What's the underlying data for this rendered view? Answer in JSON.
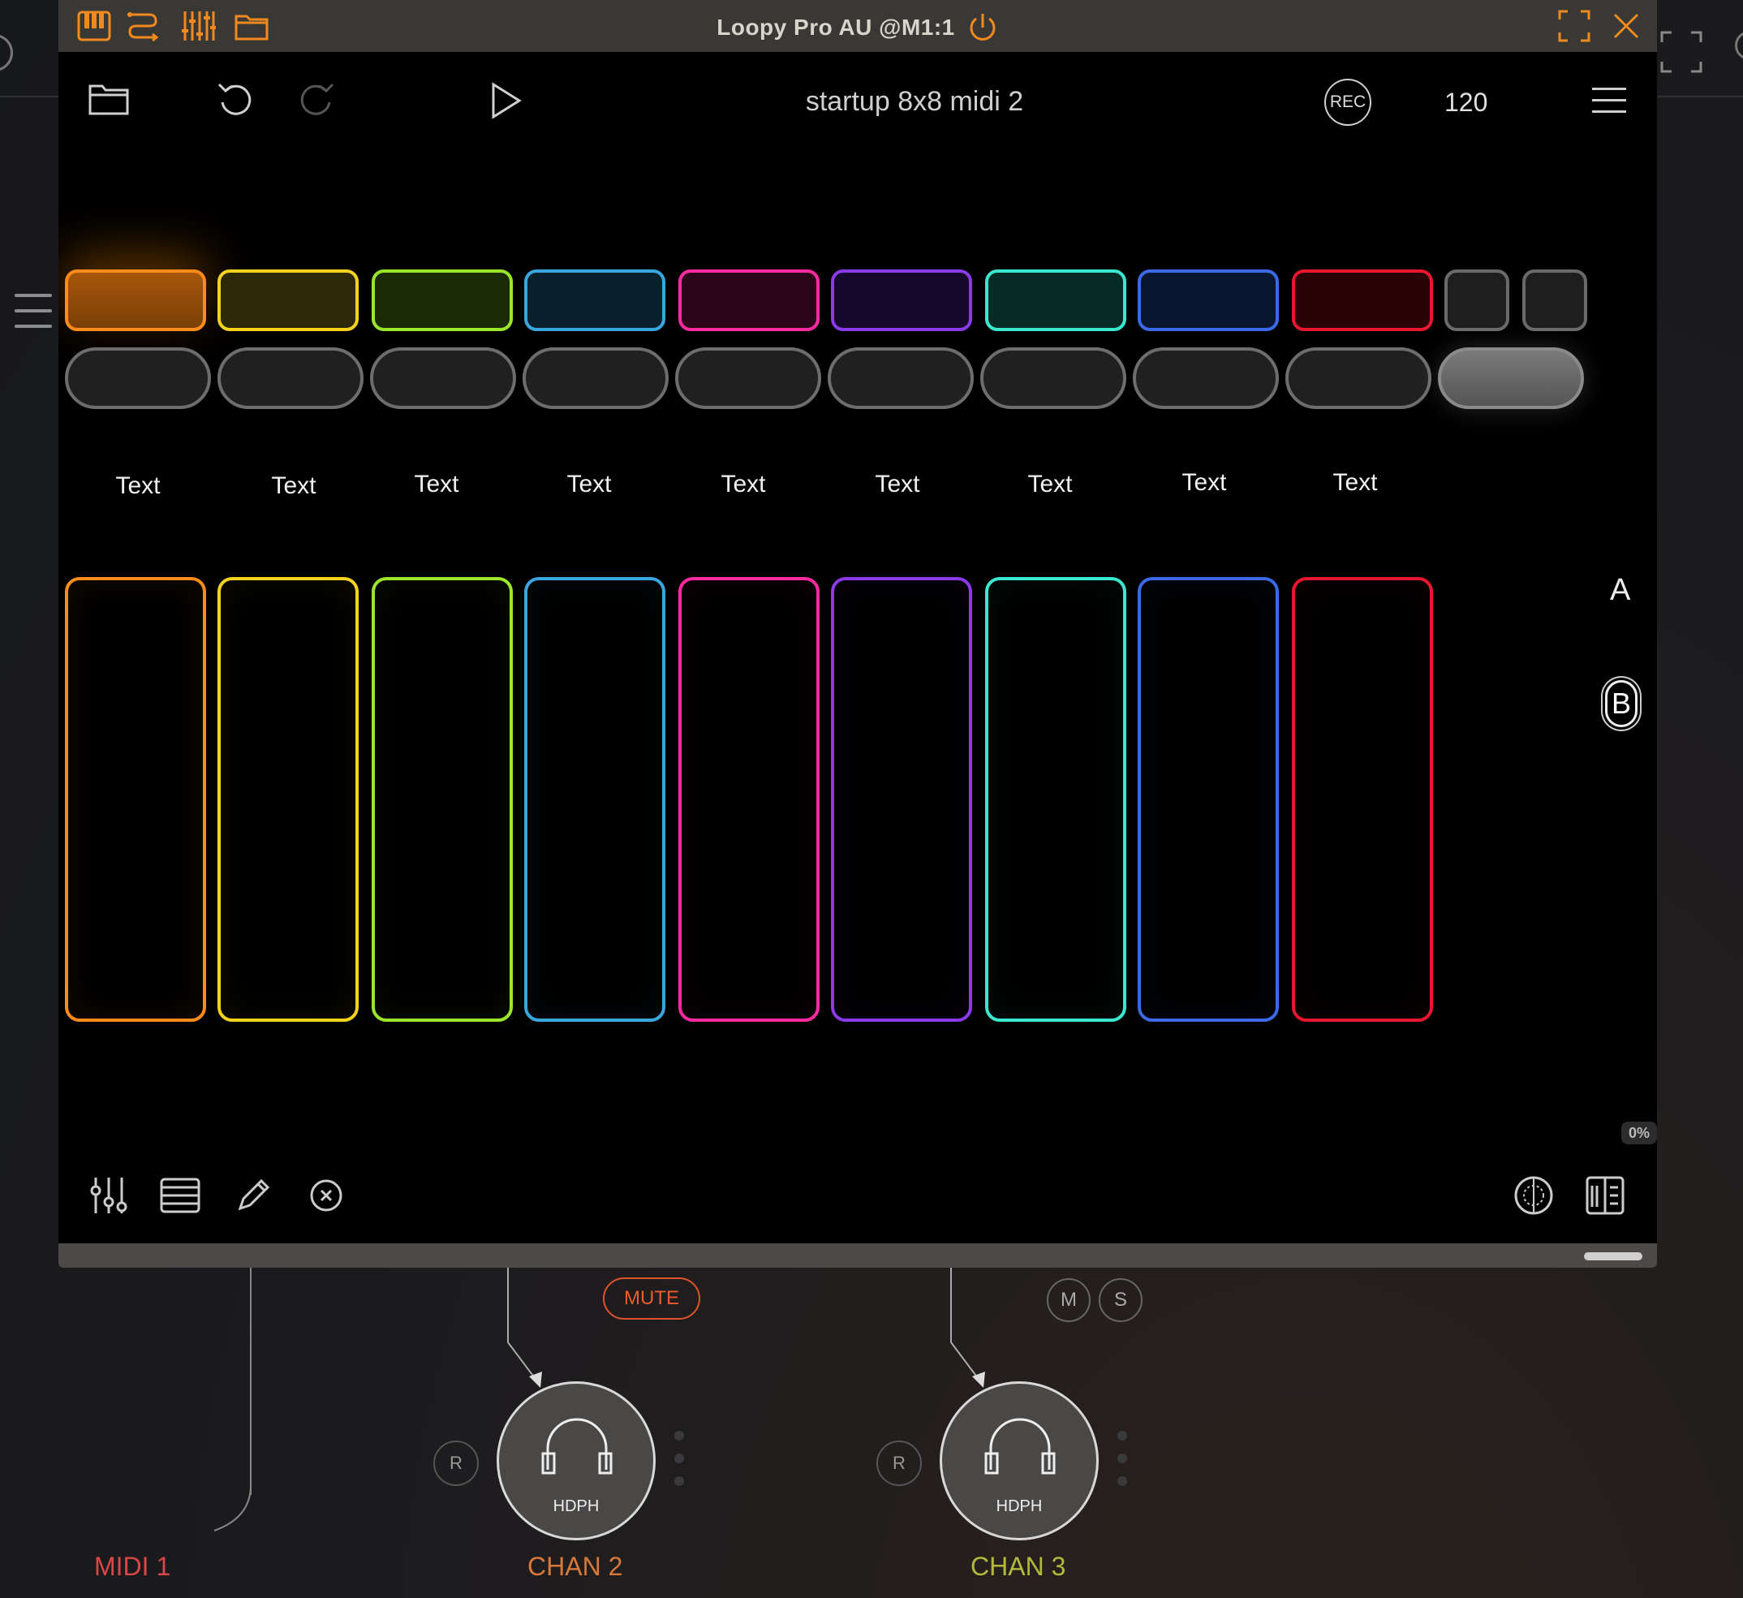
{
  "window": {
    "title": "Loopy Pro AU @M1:1"
  },
  "toolbar": {
    "song_title": "startup 8x8 midi 2",
    "rec_label": "REC",
    "tempo": "120"
  },
  "pad_labels": [
    "Text",
    "Text",
    "Text",
    "Text",
    "Text",
    "Text",
    "Text",
    "Text",
    "Text"
  ],
  "colors": {
    "orange": "#ff8c1a",
    "yellow": "#f5d21c",
    "green": "#9be52b",
    "cyan": "#3aa6e0",
    "pink": "#ff2aa0",
    "purple": "#8a3ae8",
    "teal": "#3ae8d0",
    "blue": "#3a6ae8",
    "red": "#e8162e",
    "mute_red": "#ee5a2d",
    "midi_label": "#d84848",
    "chan2_label": "#d8783a",
    "chan3_label": "#b4b83a"
  },
  "scenes": {
    "a_label": "A",
    "b_label": "B"
  },
  "cpu_label": "0%",
  "mixer": {
    "mute_label": "MUTE",
    "m_label": "M",
    "s_label": "S",
    "r_label": "R",
    "hdph_label": "HDPH",
    "midi1_label": "MIDI 1",
    "chan2_label": "CHAN 2",
    "chan3_label": "CHAN 3"
  }
}
